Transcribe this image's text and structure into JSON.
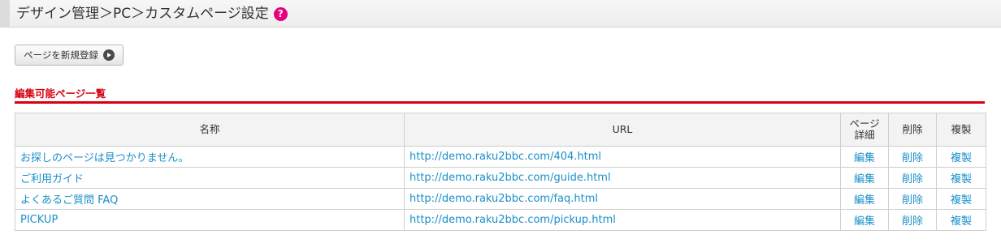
{
  "header": {
    "title": "デザイン管理＞PC＞カスタムページ設定",
    "help_icon": "?"
  },
  "toolbar": {
    "add_label": "ページを新規登録"
  },
  "section": {
    "title": "編集可能ページ一覧"
  },
  "table": {
    "columns": {
      "name": "名称",
      "url": "URL",
      "detail_line1": "ページ",
      "detail_line2": "詳細",
      "delete": "削除",
      "copy": "複製"
    },
    "rows": [
      {
        "name": "お探しのページは見つかりません。",
        "url": "http://demo.raku2bbc.com/404.html",
        "edit": "編集",
        "delete": "削除",
        "copy": "複製"
      },
      {
        "name": "ご利用ガイド",
        "url": "http://demo.raku2bbc.com/guide.html",
        "edit": "編集",
        "delete": "削除",
        "copy": "複製"
      },
      {
        "name": "よくあるご質問 FAQ",
        "url": "http://demo.raku2bbc.com/faq.html",
        "edit": "編集",
        "delete": "削除",
        "copy": "複製"
      },
      {
        "name": "PICKUP",
        "url": "http://demo.raku2bbc.com/pickup.html",
        "edit": "編集",
        "delete": "削除",
        "copy": "複製"
      }
    ]
  },
  "colors": {
    "accent_red": "#d8000f",
    "link_blue": "#1a8fc9",
    "help_pink": "#e5007f"
  }
}
